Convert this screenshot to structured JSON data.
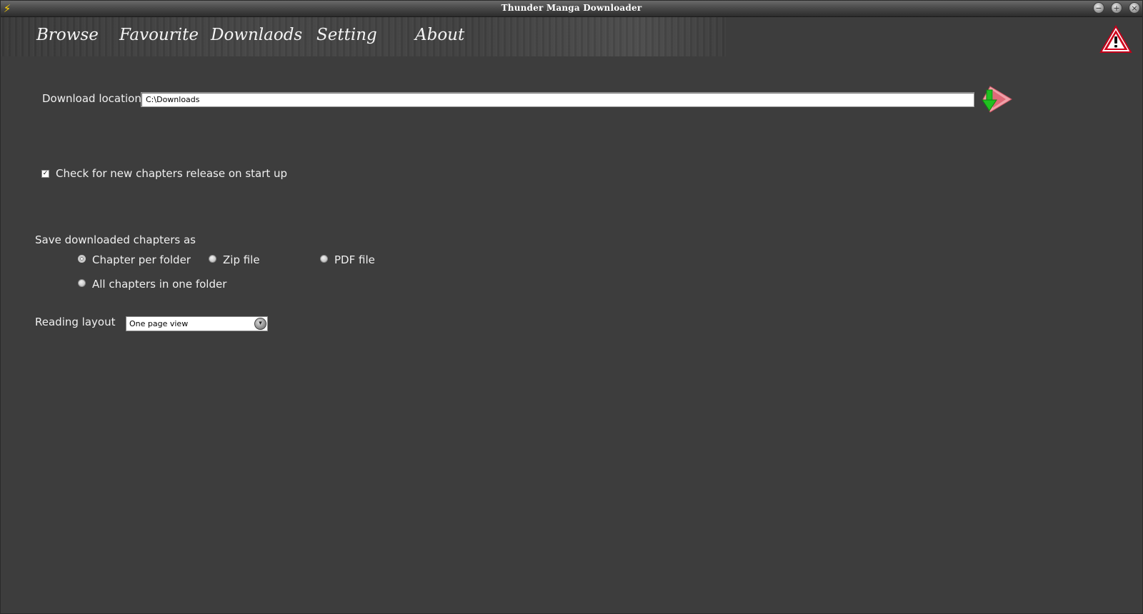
{
  "window": {
    "title": "Thunder Manga Downloader",
    "minimize_glyph": "−",
    "maximize_glyph": "+",
    "close_glyph": "×",
    "app_icon_glyph": "⚡"
  },
  "nav": {
    "items": [
      {
        "label": "Browse"
      },
      {
        "label": "Favourite"
      },
      {
        "label": "Downlaods"
      },
      {
        "label": "Setting"
      },
      {
        "label": "About"
      }
    ]
  },
  "settings": {
    "download_location": {
      "label": "Download location",
      "value": "C:\\Downloads"
    },
    "check_updates": {
      "checked": true,
      "check_glyph": "✓",
      "label": "Check for new chapters release on start up"
    },
    "save_as": {
      "label": "Save downloaded chapters as",
      "options": [
        {
          "label": "Chapter per folder",
          "selected": true
        },
        {
          "label": "Zip file",
          "selected": false
        },
        {
          "label": "PDF file",
          "selected": false
        },
        {
          "label": "All chapters in one folder",
          "selected": false
        }
      ]
    },
    "reading_layout": {
      "label": "Reading layout",
      "value": "One page view",
      "arrow_glyph": "▾"
    }
  },
  "icons": {
    "warning": "warning-triangle-icon",
    "browse_folder": "download-arrow-icon"
  },
  "colors": {
    "background": "#3d3d3d",
    "warning_red": "#d0021b",
    "arrow_green": "#22c022",
    "arrow_pink": "#e8707a"
  }
}
